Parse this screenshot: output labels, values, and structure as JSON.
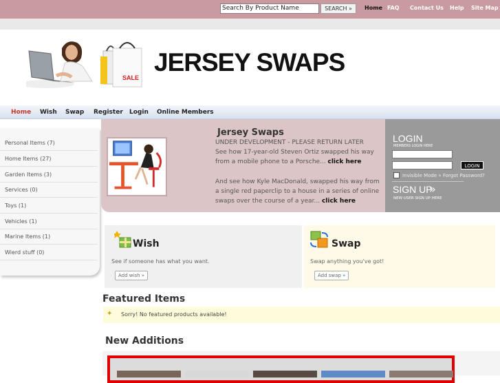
{
  "topbar": {
    "search_placeholder": "Search By Product Name",
    "search_button": "SEARCH  »",
    "links": [
      "Home",
      "FAQ",
      "Contact Us",
      "Help",
      "Site Map"
    ]
  },
  "header": {
    "site_title": "JERSEY SWAPS",
    "bag_text": "SALE"
  },
  "nav": {
    "items": [
      "Home",
      "Wish",
      "Swap",
      "Register",
      "Login",
      "Online Members"
    ],
    "active": "Home"
  },
  "sidebar": {
    "items": [
      "Personal Items (7)",
      "Home Items (27)",
      "Garden Items (3)",
      "Services (0)",
      "Toys (1)",
      "Vehicles (1)",
      "Marine Items (1)",
      "Wierd stuff (0)"
    ]
  },
  "hero": {
    "title": "Jersey Swaps",
    "status": "UNDER DEVELOPMENT - PLEASE RETURN LATER",
    "para1": "See how 17-year-old Steven Ortiz swapped his way from a mobile phone to a Porsche...",
    "para1_link": "click here",
    "para2": "And see how Kyle MacDonald, swapped his way from a single red paperclip to a house in a series of online swaps over the course of a year...",
    "para2_link": "click here"
  },
  "login": {
    "title": "LOGIN",
    "subtitle": "MEMBERS LOGIN HERE",
    "button": "LOGIN",
    "invisible_mode": "Invisible Mode",
    "forgot": "Forgot Password?",
    "signup_title": "SIGN UP",
    "signup_sub": "NEW USER SIGN UP HERE"
  },
  "wish_box": {
    "title": "Wish",
    "text": "See if someone has what you want.",
    "button": "Add wish »"
  },
  "swap_box": {
    "title": "Swap",
    "text": "Swap anything you've got!",
    "button": "Add swap »"
  },
  "featured": {
    "title": "Featured Items",
    "message": "Sorry! No featured products available!"
  },
  "new_additions": {
    "title": "New Additions"
  },
  "colors": {
    "topbar": "#c99a9f",
    "hero": "#dbc5c7",
    "login_panel": "#9a9a9a",
    "nav_active": "#c0392b",
    "new_frame": "#e00000"
  }
}
